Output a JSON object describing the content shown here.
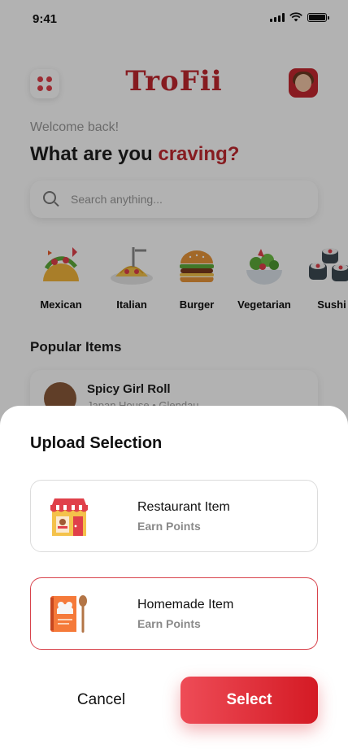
{
  "status_bar": {
    "time": "9:41"
  },
  "header": {
    "app_name": "TroFii"
  },
  "greeting": {
    "welcome": "Welcome back!",
    "question_prefix": "What are you ",
    "question_accent": "craving?"
  },
  "search": {
    "placeholder": "Search anything..."
  },
  "categories": [
    {
      "label": "Mexican",
      "icon": "taco-icon"
    },
    {
      "label": "Italian",
      "icon": "pasta-icon"
    },
    {
      "label": "Burger",
      "icon": "burger-icon"
    },
    {
      "label": "Vegetarian",
      "icon": "salad-icon"
    },
    {
      "label": "Sushi",
      "icon": "sushi-icon"
    }
  ],
  "popular": {
    "title": "Popular Items",
    "items": [
      {
        "name": "Spicy Girl Roll",
        "subtitle": "Japan House • Glendau"
      }
    ]
  },
  "sheet": {
    "title": "Upload Selection",
    "options": [
      {
        "name": "Restaurant Item",
        "subtitle": "Earn Points",
        "icon": "restaurant-icon",
        "selected": false
      },
      {
        "name": "Homemade Item",
        "subtitle": "Earn Points",
        "icon": "cookbook-icon",
        "selected": true
      }
    ],
    "cancel_label": "Cancel",
    "select_label": "Select"
  },
  "colors": {
    "accent": "#c0282e",
    "button_start": "#ee4c57",
    "button_end": "#d41a24"
  }
}
